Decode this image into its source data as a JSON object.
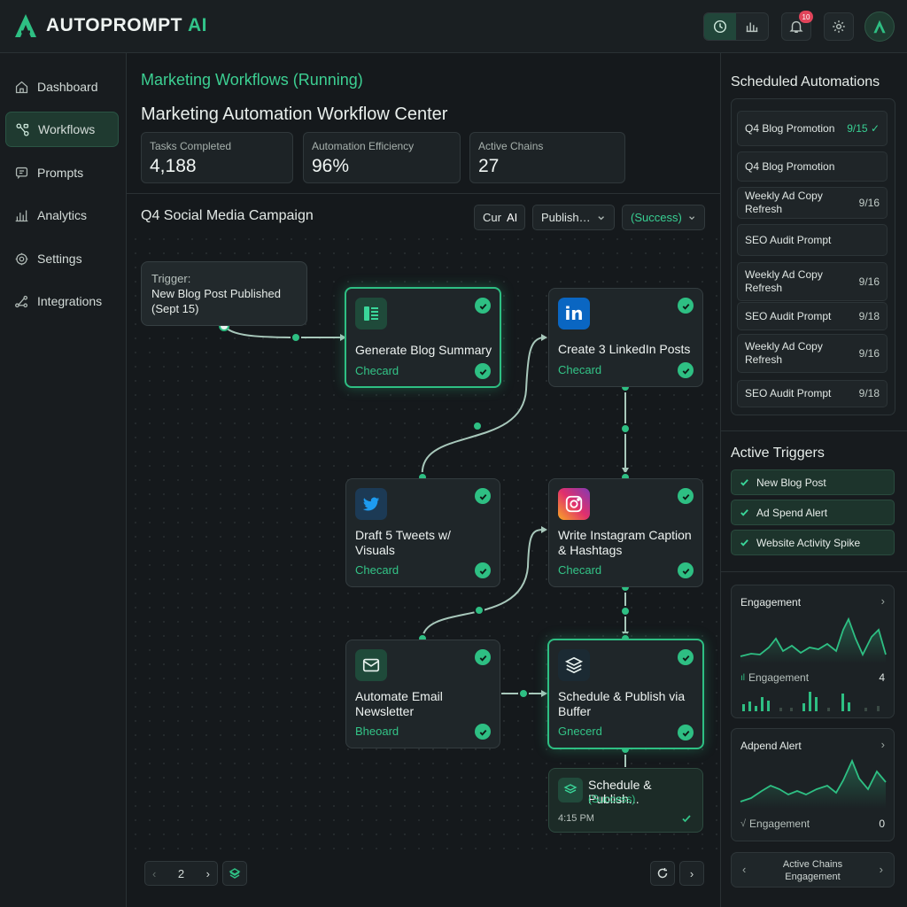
{
  "app": {
    "logo_text": "AUTOPROMPT",
    "logo_ai": "AI",
    "notification_count": "10"
  },
  "sidebar": {
    "items": [
      {
        "label": "Dashboard",
        "icon": "home-icon"
      },
      {
        "label": "Workflows",
        "icon": "workflow-icon",
        "active": true
      },
      {
        "label": "Prompts",
        "icon": "prompt-icon"
      },
      {
        "label": "Analytics",
        "icon": "bar-chart-icon"
      },
      {
        "label": "Settings",
        "icon": "gear-icon"
      },
      {
        "label": "Integrations",
        "icon": "integration-icon"
      }
    ]
  },
  "main": {
    "subtitle": "Marketing Workflows (Running)",
    "title": "Marketing Automation Workflow Center",
    "stats": [
      {
        "label": "Tasks Completed",
        "value": "4,188"
      },
      {
        "label": "Automation Efficiency",
        "value": "96%"
      },
      {
        "label": "Active Chains",
        "value": "27"
      }
    ],
    "campaign": "Q4 Social Media Campaign",
    "filters": {
      "f1_a": "Cur",
      "f1_b": "AI",
      "f2": "Publish…",
      "f3": "(Success)"
    },
    "trigger": {
      "label": "Trigger:",
      "line1": "New Blog Post Published",
      "line2": "(Sept 15)"
    },
    "nodes": {
      "blog": {
        "title": "Generate Blog Summary",
        "status": "Checard"
      },
      "linkedin": {
        "title": "Create 3 LinkedIn Posts",
        "status": "Checard"
      },
      "tweets": {
        "title_1": "Draft 5 Tweets w/",
        "title_2": "Visuals",
        "status": "Checard"
      },
      "instagram": {
        "title_1": "Write Instagram Caption",
        "title_2": "& Hashtags",
        "status": "Checard"
      },
      "email": {
        "title_1": "Automate Email",
        "title_2": "Newsletter",
        "status": "Bheoard"
      },
      "buffer": {
        "title_1": "Schedule & Publish via",
        "title_2": "Buffer",
        "status": "Gnecerd"
      },
      "final": {
        "title": "Schedule & Publish...",
        "status": "(Success)",
        "time": "4:15 PM"
      }
    },
    "pager": {
      "page": "2"
    }
  },
  "right": {
    "scheduled_title": "Scheduled Automations",
    "scheduled": [
      {
        "name": "Q4 Blog Promotion",
        "num": "9/15 ✓"
      },
      {
        "name": "Q4 Blog Promotion",
        "num": ""
      },
      {
        "name": "Weekly Ad Copy Refresh",
        "num": "9/16"
      },
      {
        "name": "SEO Audit Prompt",
        "num": ""
      },
      {
        "name_1": "Weekly Ad Copy",
        "name_2": "Refresh",
        "num": "9/16"
      },
      {
        "name": "SEO Audit Prompt",
        "num": "9/18"
      },
      {
        "name_1": "Weekly Ad Copy",
        "name_2": "Refresh",
        "num": "9/16"
      },
      {
        "name": "SEO Audit Prompt",
        "num": "9/18"
      }
    ],
    "triggers_title": "Active Triggers",
    "triggers": [
      "New Blog Post",
      "Ad Spend Alert",
      "Website Activity Spike"
    ],
    "card1": {
      "title": "Engagement",
      "metric": "Engagement",
      "value": "4"
    },
    "card2": {
      "title": "Adpend Alert",
      "metric": "Engagement",
      "value": "0"
    },
    "footer": {
      "line1": "Active Chains",
      "line2": "Engagement"
    }
  },
  "colors": {
    "accent": "#2ebf83",
    "background": "#161a1d",
    "panel": "#1f2629"
  }
}
